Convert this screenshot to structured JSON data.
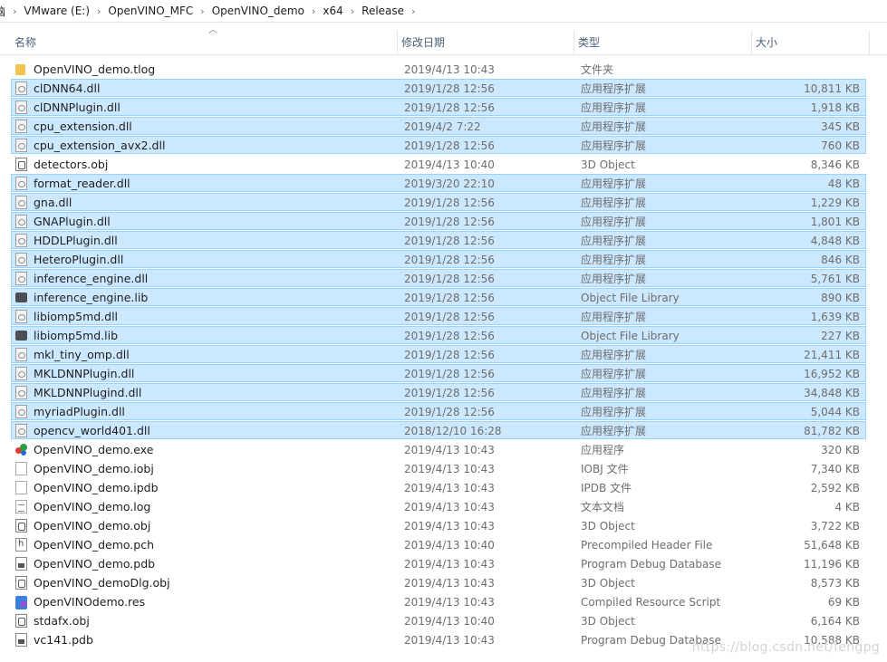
{
  "breadcrumb": [
    "脑",
    "VMware (E:)",
    "OpenVINO_MFC",
    "OpenVINO_demo",
    "x64",
    "Release"
  ],
  "columns": {
    "name": "名称",
    "date": "修改日期",
    "type": "类型",
    "size": "大小"
  },
  "rows": [
    {
      "name": "OpenVINO_demo.tlog",
      "date": "2019/4/13 10:43",
      "type": "文件夹",
      "size": "",
      "icon": "folder-icon",
      "selected": false
    },
    {
      "name": "clDNN64.dll",
      "date": "2019/1/28 12:56",
      "type": "应用程序扩展",
      "size": "10,811 KB",
      "icon": "dll-icon",
      "selected": true
    },
    {
      "name": "clDNNPlugin.dll",
      "date": "2019/1/28 12:56",
      "type": "应用程序扩展",
      "size": "1,918 KB",
      "icon": "dll-icon",
      "selected": true
    },
    {
      "name": "cpu_extension.dll",
      "date": "2019/4/2 7:22",
      "type": "应用程序扩展",
      "size": "345 KB",
      "icon": "dll-icon",
      "selected": true
    },
    {
      "name": "cpu_extension_avx2.dll",
      "date": "2019/1/28 12:56",
      "type": "应用程序扩展",
      "size": "760 KB",
      "icon": "dll-icon",
      "selected": true
    },
    {
      "name": "detectors.obj",
      "date": "2019/4/13 10:40",
      "type": "3D Object",
      "size": "8,346 KB",
      "icon": "obj-icon",
      "selected": false
    },
    {
      "name": "format_reader.dll",
      "date": "2019/3/20 22:10",
      "type": "应用程序扩展",
      "size": "48 KB",
      "icon": "dll-icon",
      "selected": true
    },
    {
      "name": "gna.dll",
      "date": "2019/1/28 12:56",
      "type": "应用程序扩展",
      "size": "1,229 KB",
      "icon": "dll-icon",
      "selected": true
    },
    {
      "name": "GNAPlugin.dll",
      "date": "2019/1/28 12:56",
      "type": "应用程序扩展",
      "size": "1,801 KB",
      "icon": "dll-icon",
      "selected": true
    },
    {
      "name": "HDDLPlugin.dll",
      "date": "2019/1/28 12:56",
      "type": "应用程序扩展",
      "size": "4,848 KB",
      "icon": "dll-icon",
      "selected": true
    },
    {
      "name": "HeteroPlugin.dll",
      "date": "2019/1/28 12:56",
      "type": "应用程序扩展",
      "size": "846 KB",
      "icon": "dll-icon",
      "selected": true
    },
    {
      "name": "inference_engine.dll",
      "date": "2019/1/28 12:56",
      "type": "应用程序扩展",
      "size": "5,761 KB",
      "icon": "dll-icon",
      "selected": true
    },
    {
      "name": "inference_engine.lib",
      "date": "2019/1/28 12:56",
      "type": "Object File Library",
      "size": "890 KB",
      "icon": "lib-icon",
      "selected": true
    },
    {
      "name": "libiomp5md.dll",
      "date": "2019/1/28 12:56",
      "type": "应用程序扩展",
      "size": "1,639 KB",
      "icon": "dll-icon",
      "selected": true
    },
    {
      "name": "libiomp5md.lib",
      "date": "2019/1/28 12:56",
      "type": "Object File Library",
      "size": "227 KB",
      "icon": "lib-icon",
      "selected": true
    },
    {
      "name": "mkl_tiny_omp.dll",
      "date": "2019/1/28 12:56",
      "type": "应用程序扩展",
      "size": "21,411 KB",
      "icon": "dll-icon",
      "selected": true
    },
    {
      "name": "MKLDNNPlugin.dll",
      "date": "2019/1/28 12:56",
      "type": "应用程序扩展",
      "size": "16,952 KB",
      "icon": "dll-icon",
      "selected": true
    },
    {
      "name": "MKLDNNPlugind.dll",
      "date": "2019/1/28 12:56",
      "type": "应用程序扩展",
      "size": "34,848 KB",
      "icon": "dll-icon",
      "selected": true
    },
    {
      "name": "myriadPlugin.dll",
      "date": "2019/1/28 12:56",
      "type": "应用程序扩展",
      "size": "5,044 KB",
      "icon": "dll-icon",
      "selected": true
    },
    {
      "name": "opencv_world401.dll",
      "date": "2018/12/10 16:28",
      "type": "应用程序扩展",
      "size": "81,782 KB",
      "icon": "dll-icon",
      "selected": true
    },
    {
      "name": "OpenVINO_demo.exe",
      "date": "2019/4/13 10:43",
      "type": "应用程序",
      "size": "320 KB",
      "icon": "exe-icon",
      "selected": false
    },
    {
      "name": "OpenVINO_demo.iobj",
      "date": "2019/4/13 10:43",
      "type": "IOBJ 文件",
      "size": "7,340 KB",
      "icon": "blank-file-icon",
      "selected": false
    },
    {
      "name": "OpenVINO_demo.ipdb",
      "date": "2019/4/13 10:43",
      "type": "IPDB 文件",
      "size": "2,592 KB",
      "icon": "blank-file-icon",
      "selected": false
    },
    {
      "name": "OpenVINO_demo.log",
      "date": "2019/4/13 10:43",
      "type": "文本文档",
      "size": "4 KB",
      "icon": "log-icon",
      "selected": false
    },
    {
      "name": "OpenVINO_demo.obj",
      "date": "2019/4/13 10:43",
      "type": "3D Object",
      "size": "3,722 KB",
      "icon": "obj-icon",
      "selected": false
    },
    {
      "name": "OpenVINO_demo.pch",
      "date": "2019/4/13 10:40",
      "type": "Precompiled Header File",
      "size": "51,648 KB",
      "icon": "pch-icon",
      "selected": false
    },
    {
      "name": "OpenVINO_demo.pdb",
      "date": "2019/4/13 10:43",
      "type": "Program Debug Database",
      "size": "11,196 KB",
      "icon": "pdb-icon",
      "selected": false
    },
    {
      "name": "OpenVINO_demoDlg.obj",
      "date": "2019/4/13 10:43",
      "type": "3D Object",
      "size": "8,573 KB",
      "icon": "obj-icon",
      "selected": false
    },
    {
      "name": "OpenVINOdemo.res",
      "date": "2019/4/13 10:43",
      "type": "Compiled Resource Script",
      "size": "69 KB",
      "icon": "res-icon",
      "selected": false
    },
    {
      "name": "stdafx.obj",
      "date": "2019/4/13 10:40",
      "type": "3D Object",
      "size": "6,164 KB",
      "icon": "obj-icon",
      "selected": false
    },
    {
      "name": "vc141.pdb",
      "date": "2019/4/13 10:43",
      "type": "Program Debug Database",
      "size": "10,588 KB",
      "icon": "pdb-icon",
      "selected": false
    }
  ],
  "watermark": "https://blog.csdn.net/fengpg",
  "colors": {
    "selection_bg": "#cce8ff",
    "selection_border": "#99d1ff",
    "header_text": "#4c607a",
    "secondary_text": "#6d6d6d"
  }
}
